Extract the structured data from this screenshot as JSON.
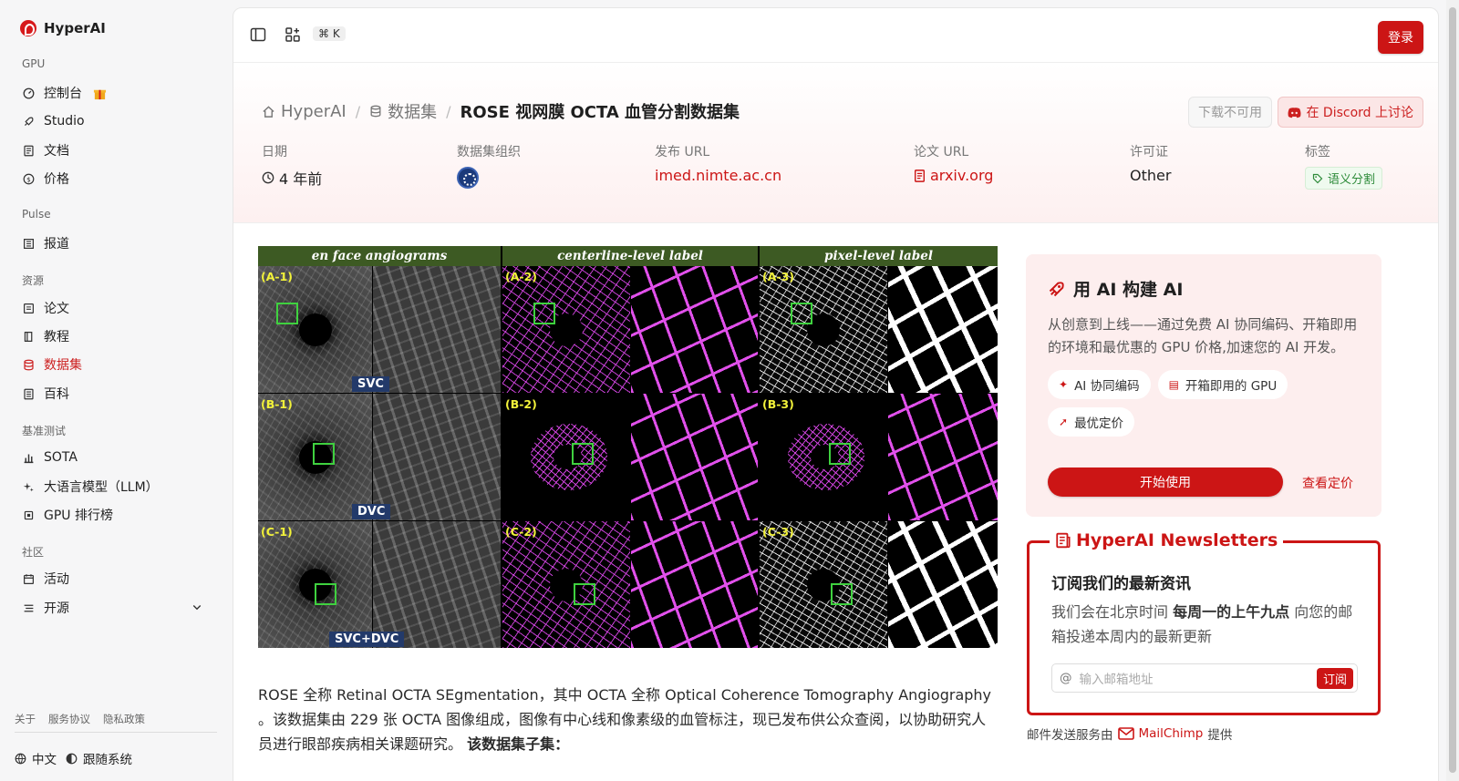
{
  "brand": {
    "name": "HyperAI"
  },
  "sidebar": {
    "sections": [
      "GPU",
      "Pulse",
      "资源",
      "基准测试",
      "社区"
    ],
    "items": [
      {
        "label": "控制台",
        "icon": "dashboard-icon"
      },
      {
        "label": "Studio",
        "icon": "rocket-icon"
      },
      {
        "label": "文档",
        "icon": "doc-icon"
      },
      {
        "label": "价格",
        "icon": "dollar-icon"
      },
      {
        "label": "报道",
        "icon": "news-icon"
      },
      {
        "label": "论文",
        "icon": "paper-icon"
      },
      {
        "label": "教程",
        "icon": "book-icon"
      },
      {
        "label": "数据集",
        "icon": "database-icon",
        "active": true
      },
      {
        "label": "百科",
        "icon": "wiki-icon"
      },
      {
        "label": "SOTA",
        "icon": "chart-icon"
      },
      {
        "label": "大语言模型（LLM）",
        "icon": "sparkles-icon"
      },
      {
        "label": "GPU 排行榜",
        "icon": "chip-icon"
      },
      {
        "label": "活动",
        "icon": "calendar-icon"
      },
      {
        "label": "开源",
        "icon": "list-icon"
      }
    ],
    "footer_links": [
      "关于",
      "服务协议",
      "隐私政策"
    ],
    "language": "中文",
    "theme": "跟随系统"
  },
  "topbar": {
    "shortcut": "⌘ K",
    "login_label": "登录"
  },
  "breadcrumb": {
    "home": "HyperAI",
    "section": "数据集",
    "current": "ROSE 视网膜 OCTA 血管分割数据集"
  },
  "hero_buttons": {
    "download": "下载不可用",
    "discord": "在 Discord 上讨论"
  },
  "meta": {
    "date_label": "日期",
    "date_value": "4 年前",
    "org_label": "数据集组织",
    "url_label": "发布 URL",
    "url_value": "imed.nimte.ac.cn",
    "paper_label": "论文 URL",
    "paper_value": "arxiv.org",
    "license_label": "许可证",
    "license_value": "Other",
    "tags_label": "标签",
    "tag_value": "语义分割"
  },
  "figure": {
    "headers": [
      "en face angiograms",
      "centerline-level label",
      "pixel-level label"
    ],
    "cell_labels": [
      "(A-1)",
      "(A-2)",
      "(A-3)",
      "(B-1)",
      "(B-2)",
      "(B-3)",
      "(C-1)",
      "(C-2)",
      "(C-3)"
    ],
    "row_tags": [
      "SVC",
      "DVC",
      "SVC+DVC"
    ]
  },
  "description": {
    "text": "ROSE 全称 Retinal OCTA SEgmentation，其中 OCTA 全称 Optical Coherence Tomography Angiography 。该数据集由 229 张 OCTA 图像组成，图像有中心线和像素级的血管标注，现已发布供公众查阅，以协助研究人员进行眼部疾病相关课题研究。 ",
    "bold": "该数据集子集："
  },
  "promo": {
    "title": "用 AI 构建 AI",
    "body": "从创意到上线——通过免费 AI 协同编码、开箱即用的环境和最优惠的 GPU 价格,加速您的 AI 开发。",
    "chips": [
      "AI 协同编码",
      "开箱即用的 GPU",
      "最优定价"
    ],
    "start_label": "开始使用",
    "pricing_label": "查看定价"
  },
  "newsletter": {
    "title": "HyperAI Newsletters",
    "heading": "订阅我们的最新资讯",
    "body_pre": "我们会在北京时间 ",
    "body_bold": "每周一的上午九点",
    "body_post": " 向您的邮箱投递本周内的最新更新",
    "placeholder": "输入邮箱地址",
    "subscribe_label": "订阅",
    "note_pre": "邮件发送服务由",
    "note_brand": "MailChimp",
    "note_post": "提供"
  },
  "colors": {
    "accent": "#cc1515"
  }
}
